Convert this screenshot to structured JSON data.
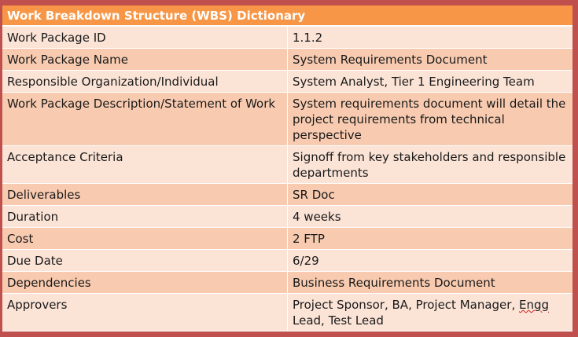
{
  "title": "Work Breakdown Structure (WBS) Dictionary",
  "rows": [
    {
      "label": "Work Package ID",
      "value": "1.1.2"
    },
    {
      "label": "Work Package Name",
      "value": "System Requirements Document"
    },
    {
      "label": "Responsible Organization/Individual",
      "value": "System Analyst, Tier 1 Engineering Team"
    },
    {
      "label": "Work Package Description/Statement of Work",
      "value": "System requirements document will detail the project requirements from technical perspective"
    },
    {
      "label": "Acceptance Criteria",
      "value": "Signoff from key stakeholders and responsible departments"
    },
    {
      "label": "Deliverables",
      "value": "SR Doc"
    },
    {
      "label": "Duration",
      "value": "4 weeks"
    },
    {
      "label": "Cost",
      "value": "2 FTP"
    },
    {
      "label": "Due Date",
      "value": "6/29"
    },
    {
      "label": "Dependencies",
      "value": "Business Requirements Document"
    },
    {
      "label": "Approvers",
      "value_before": "Project Sponsor, BA, Project Manager, ",
      "value_flagged": "Engg",
      "value_after": " Lead, Test Lead"
    }
  ]
}
